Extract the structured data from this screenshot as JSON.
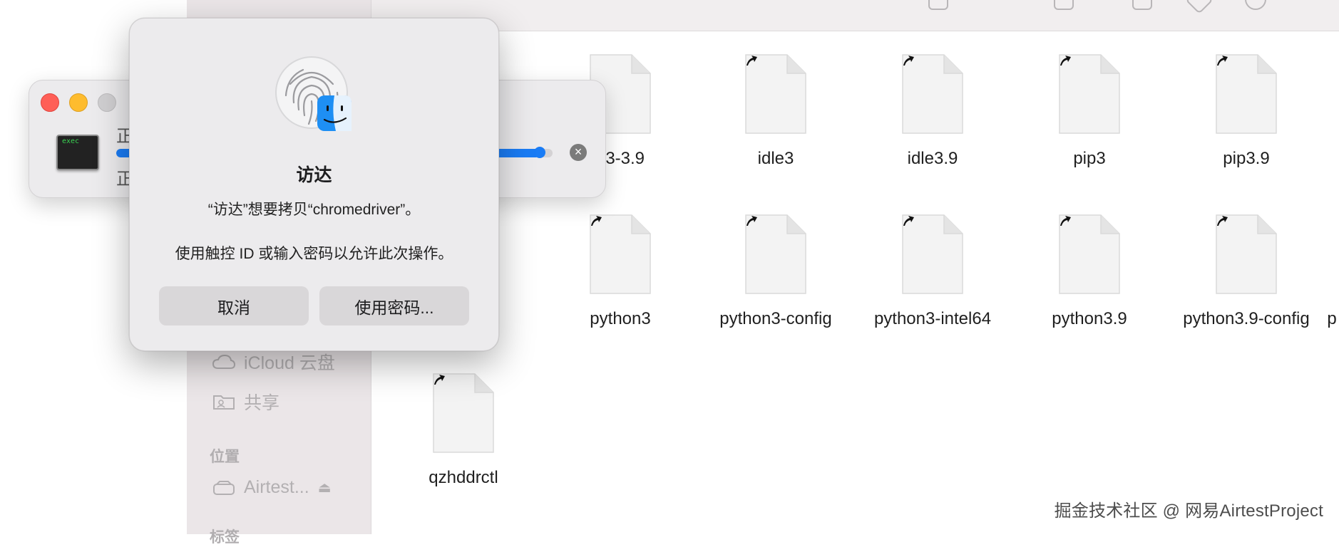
{
  "sidebar": {
    "icloud_label": "iCloud 云盘",
    "shared_label": "共享",
    "locations_header": "位置",
    "disk_label": "Airtest...",
    "bottom_header": "标签"
  },
  "files": [
    {
      "name": "p3-3.9"
    },
    {
      "name": "idle3"
    },
    {
      "name": "idle3.9"
    },
    {
      "name": "pip3"
    },
    {
      "name": "pip3.9"
    },
    {
      "name": "python3"
    },
    {
      "name": "python3-config"
    },
    {
      "name": "python3-intel64"
    },
    {
      "name": "python3.9"
    },
    {
      "name": "python3.9-config"
    },
    {
      "name": "p"
    },
    {
      "name": "qzhddrctl"
    }
  ],
  "copy_window": {
    "line1": "正",
    "line2": "正",
    "icon_text": "exec",
    "progress": 0.97
  },
  "dialog": {
    "title": "访达",
    "message": "“访达”想要拷贝“chromedriver”。",
    "prompt": "使用触控 ID 或输入密码以允许此次操作。",
    "cancel_label": "取消",
    "password_label": "使用密码..."
  },
  "watermark": "掘金技术社区 @ 网易AirtestProject",
  "colors": {
    "close": "#ff5f57",
    "minimize": "#febc2e",
    "zoom_inactive": "#d0cfd1",
    "accent": "#1a7cf5"
  }
}
